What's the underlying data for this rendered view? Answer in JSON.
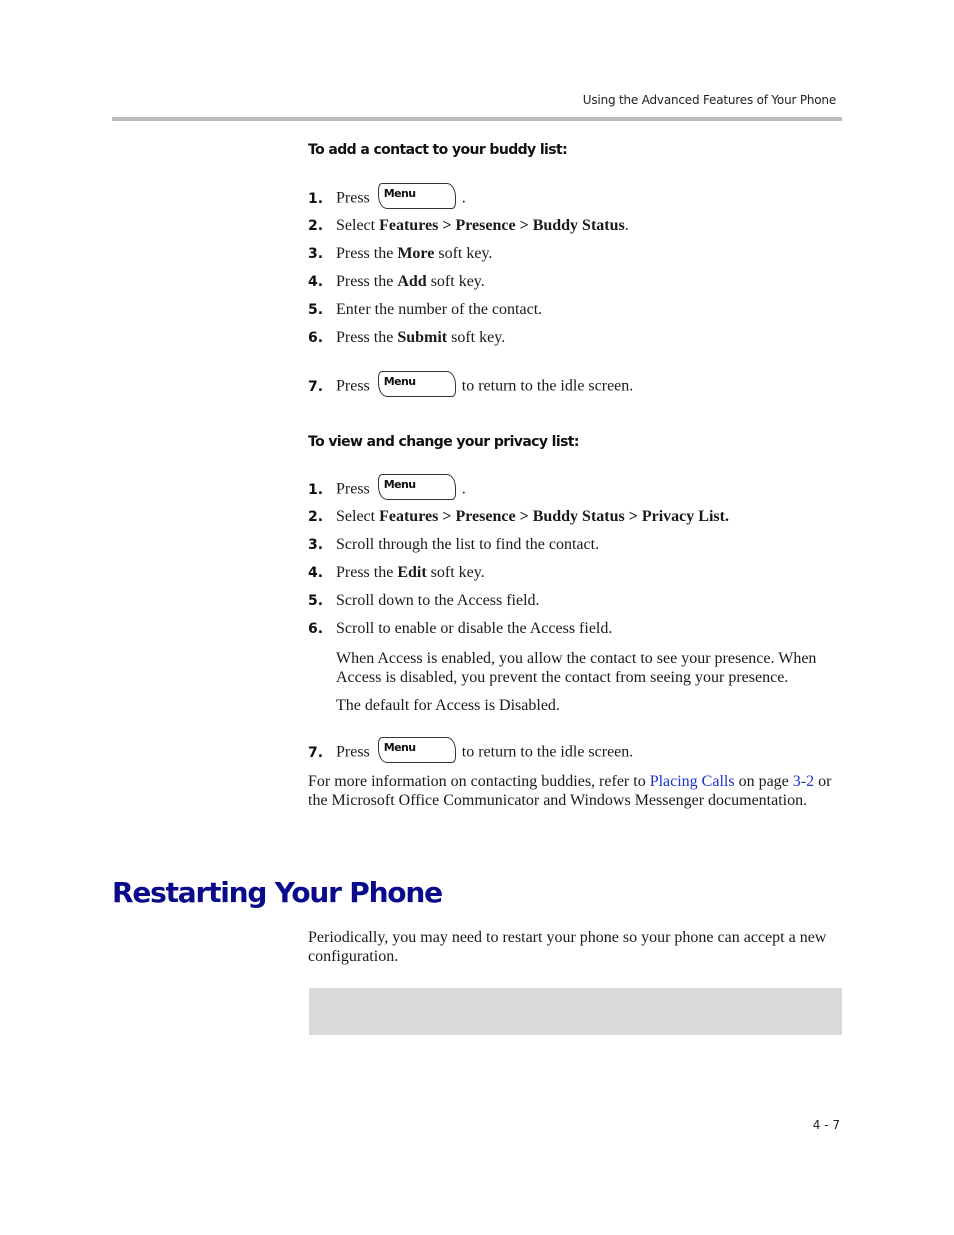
{
  "header": {
    "running_title": "Using the Advanced Features of Your Phone"
  },
  "icons": {
    "menu_key": {
      "name": "menu-key-icon",
      "label": "Menu"
    }
  },
  "buddy_list": {
    "title": "To add a contact to your buddy list:",
    "steps": [
      {
        "num": "1.",
        "pre": "Press",
        "post": "."
      },
      {
        "num": "2.",
        "pre": "Select ",
        "bold": "Features > Presence > Buddy Status",
        "post": "."
      },
      {
        "num": "3.",
        "pre": "Press the ",
        "bold": "More",
        "post": " soft key."
      },
      {
        "num": "4.",
        "pre": "Press the ",
        "bold": "Add",
        "post": " soft key."
      },
      {
        "num": "5.",
        "pre": "Enter the number of the contact."
      },
      {
        "num": "6.",
        "pre": "Press the ",
        "bold": "Submit",
        "post": " soft key."
      },
      {
        "num": "7.",
        "pre": "Press",
        "post": "to return to the idle screen."
      }
    ]
  },
  "privacy_list": {
    "title": "To view and change your privacy list:",
    "steps": [
      {
        "num": "1.",
        "pre": "Press",
        "post": "."
      },
      {
        "num": "2.",
        "pre": "Select ",
        "bold": "Features > Presence > Buddy Status > Privacy List."
      },
      {
        "num": "3.",
        "pre": "Scroll through the list to find the contact."
      },
      {
        "num": "4.",
        "pre": "Press the ",
        "bold": "Edit",
        "post": " soft key."
      },
      {
        "num": "5.",
        "pre": "Scroll down to the Access field."
      },
      {
        "num": "6.",
        "pre": "Scroll to enable or disable the Access field."
      },
      {
        "num": "7.",
        "pre": "Press",
        "post": "to return to the idle screen."
      }
    ],
    "note_1": "When Access is enabled, you allow the contact to see your presence. When Access is disabled, you prevent the contact from seeing your presence.",
    "note_2": "The default for Access is Disabled."
  },
  "more_info": {
    "text_1": "For more information on contacting buddies, refer to ",
    "link_1": "Placing Calls",
    "text_2": " on page ",
    "link_2": "3-2",
    "text_3": " or the Microsoft Office Communicator and Windows Messenger documentation."
  },
  "restart_section": {
    "title": "Restarting Your Phone",
    "body": "Periodically, you may need to restart your phone so your phone can accept a new configuration."
  },
  "footer": {
    "page_number": "4 - 7"
  }
}
